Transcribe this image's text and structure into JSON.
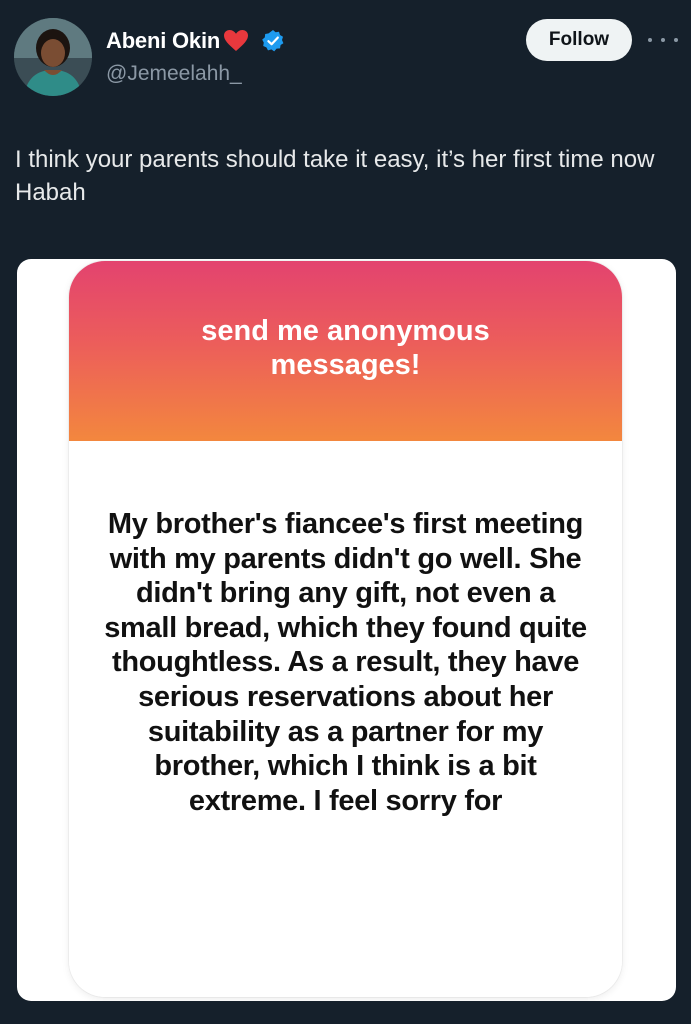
{
  "post": {
    "author": {
      "name": "Abeni Okin",
      "handle": "@Jemeelahh_",
      "avatar": "profile-photo",
      "name_emoji": "red-heart-icon",
      "verified": true
    },
    "follow_label": "Follow",
    "more_icon": "more-horizontal-icon",
    "text": "I think your parents should take it easy, it’s her first time now Habah",
    "media": {
      "card_title": "send me anonymous messages!",
      "message": "My brother's fiancee's first meeting with my parents didn't go well. She didn't bring any gift, not even a small bread, which they found quite thoughtless. As a result, they have serious reservations about her suitability as a partner for my brother, which I think is a bit extreme. I feel sorry for"
    }
  },
  "colors": {
    "background": "#15202b",
    "follow_button_bg": "#eff3f4",
    "verified_blue": "#1d9bf0",
    "handle_gray": "#8b98a5",
    "gradient_top": "#e3436f",
    "gradient_bottom": "#f3873e"
  }
}
